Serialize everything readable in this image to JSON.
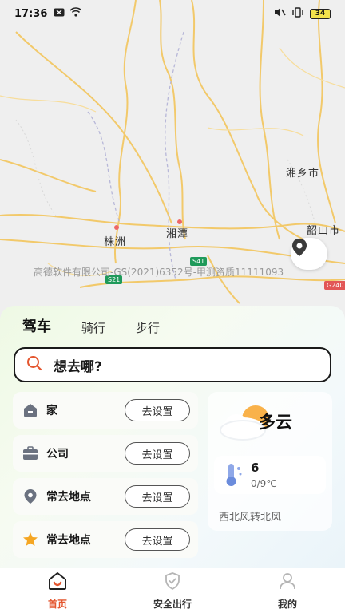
{
  "status_bar": {
    "time": "17:36",
    "battery": "34"
  },
  "map": {
    "cities": [
      "湘乡市",
      "株洲",
      "湘潭",
      "韶山市"
    ],
    "copyright": "高德软件有限公司-GS(2021)6352号-甲测资质11111093",
    "road_badges": [
      "S41",
      "S21",
      "G240"
    ]
  },
  "modes": {
    "drive": "驾车",
    "ride": "骑行",
    "walk": "步行"
  },
  "search": {
    "placeholder": "想去哪?"
  },
  "places": [
    {
      "label": "家",
      "button": "去设置",
      "icon": "home-icon"
    },
    {
      "label": "公司",
      "button": "去设置",
      "icon": "briefcase-icon"
    },
    {
      "label": "常去地点",
      "button": "去设置",
      "icon": "location-pin-icon"
    },
    {
      "label": "常去地点",
      "button": "去设置",
      "icon": "star-icon"
    }
  ],
  "weather": {
    "condition": "多云",
    "temp_now": "6",
    "temp_range": "0/9℃",
    "wind": "西北风转北风"
  },
  "nav": {
    "home": "首页",
    "safety": "安全出行",
    "mine": "我的"
  },
  "colors": {
    "accent": "#e4562f",
    "tab_highlight": "#6fd13b",
    "star": "#f5a623"
  }
}
